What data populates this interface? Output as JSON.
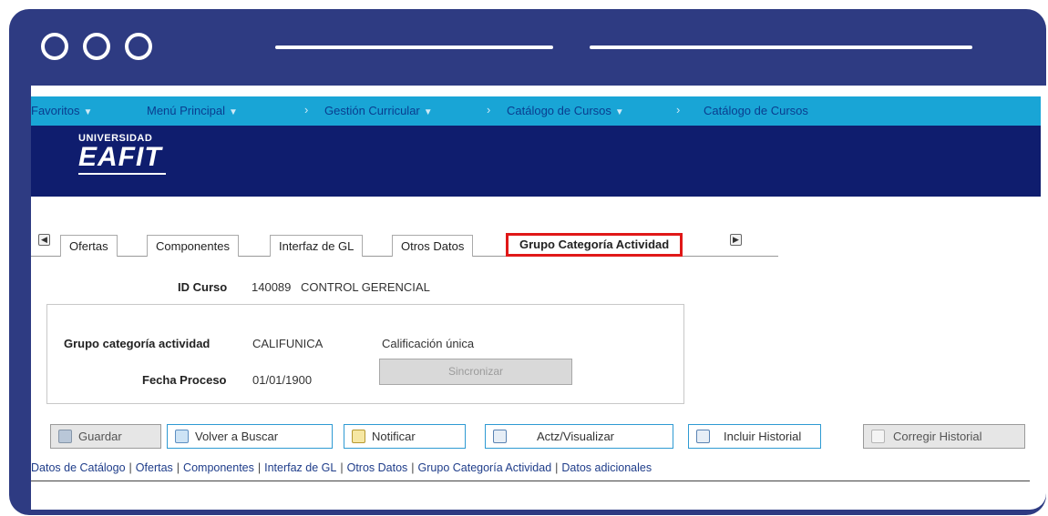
{
  "nav": {
    "items": [
      "Favoritos",
      "Menú Principal",
      "Gestión Curricular",
      "Catálogo de Cursos",
      "Catálogo de Cursos"
    ]
  },
  "logo": {
    "line1": "UNIVERSIDAD",
    "line2": "EAFIT"
  },
  "tabs": {
    "items": [
      "Ofertas",
      "Componentes",
      "Interfaz de GL",
      "Otros Datos",
      "Grupo Categoría Actividad"
    ],
    "active": "Grupo Categoría Actividad"
  },
  "course": {
    "id_label": "ID Curso",
    "id_value": "140089",
    "name": "CONTROL GERENCIAL"
  },
  "group": {
    "category_label": "Grupo categoría actividad",
    "category_value": "CALIFUNICA",
    "category_desc": "Calificación única",
    "date_label": "Fecha Proceso",
    "date_value": "01/01/1900",
    "sync_button": "Sincronizar"
  },
  "toolbar": {
    "save": "Guardar",
    "back_search": "Volver a Buscar",
    "notify": "Notificar",
    "refresh": "Actz/Visualizar",
    "include_history": "Incluir Historial",
    "correct_history": "Corregir Historial"
  },
  "links": [
    "Datos de Catálogo",
    "Ofertas",
    "Componentes",
    "Interfaz de GL",
    "Otros Datos",
    "Grupo Categoría Actividad",
    "Datos adicionales"
  ],
  "colors": {
    "frame": "#2e3b82",
    "navbar": "#19a5d6",
    "banner": "#0f1d6e",
    "highlight": "#e01818"
  }
}
